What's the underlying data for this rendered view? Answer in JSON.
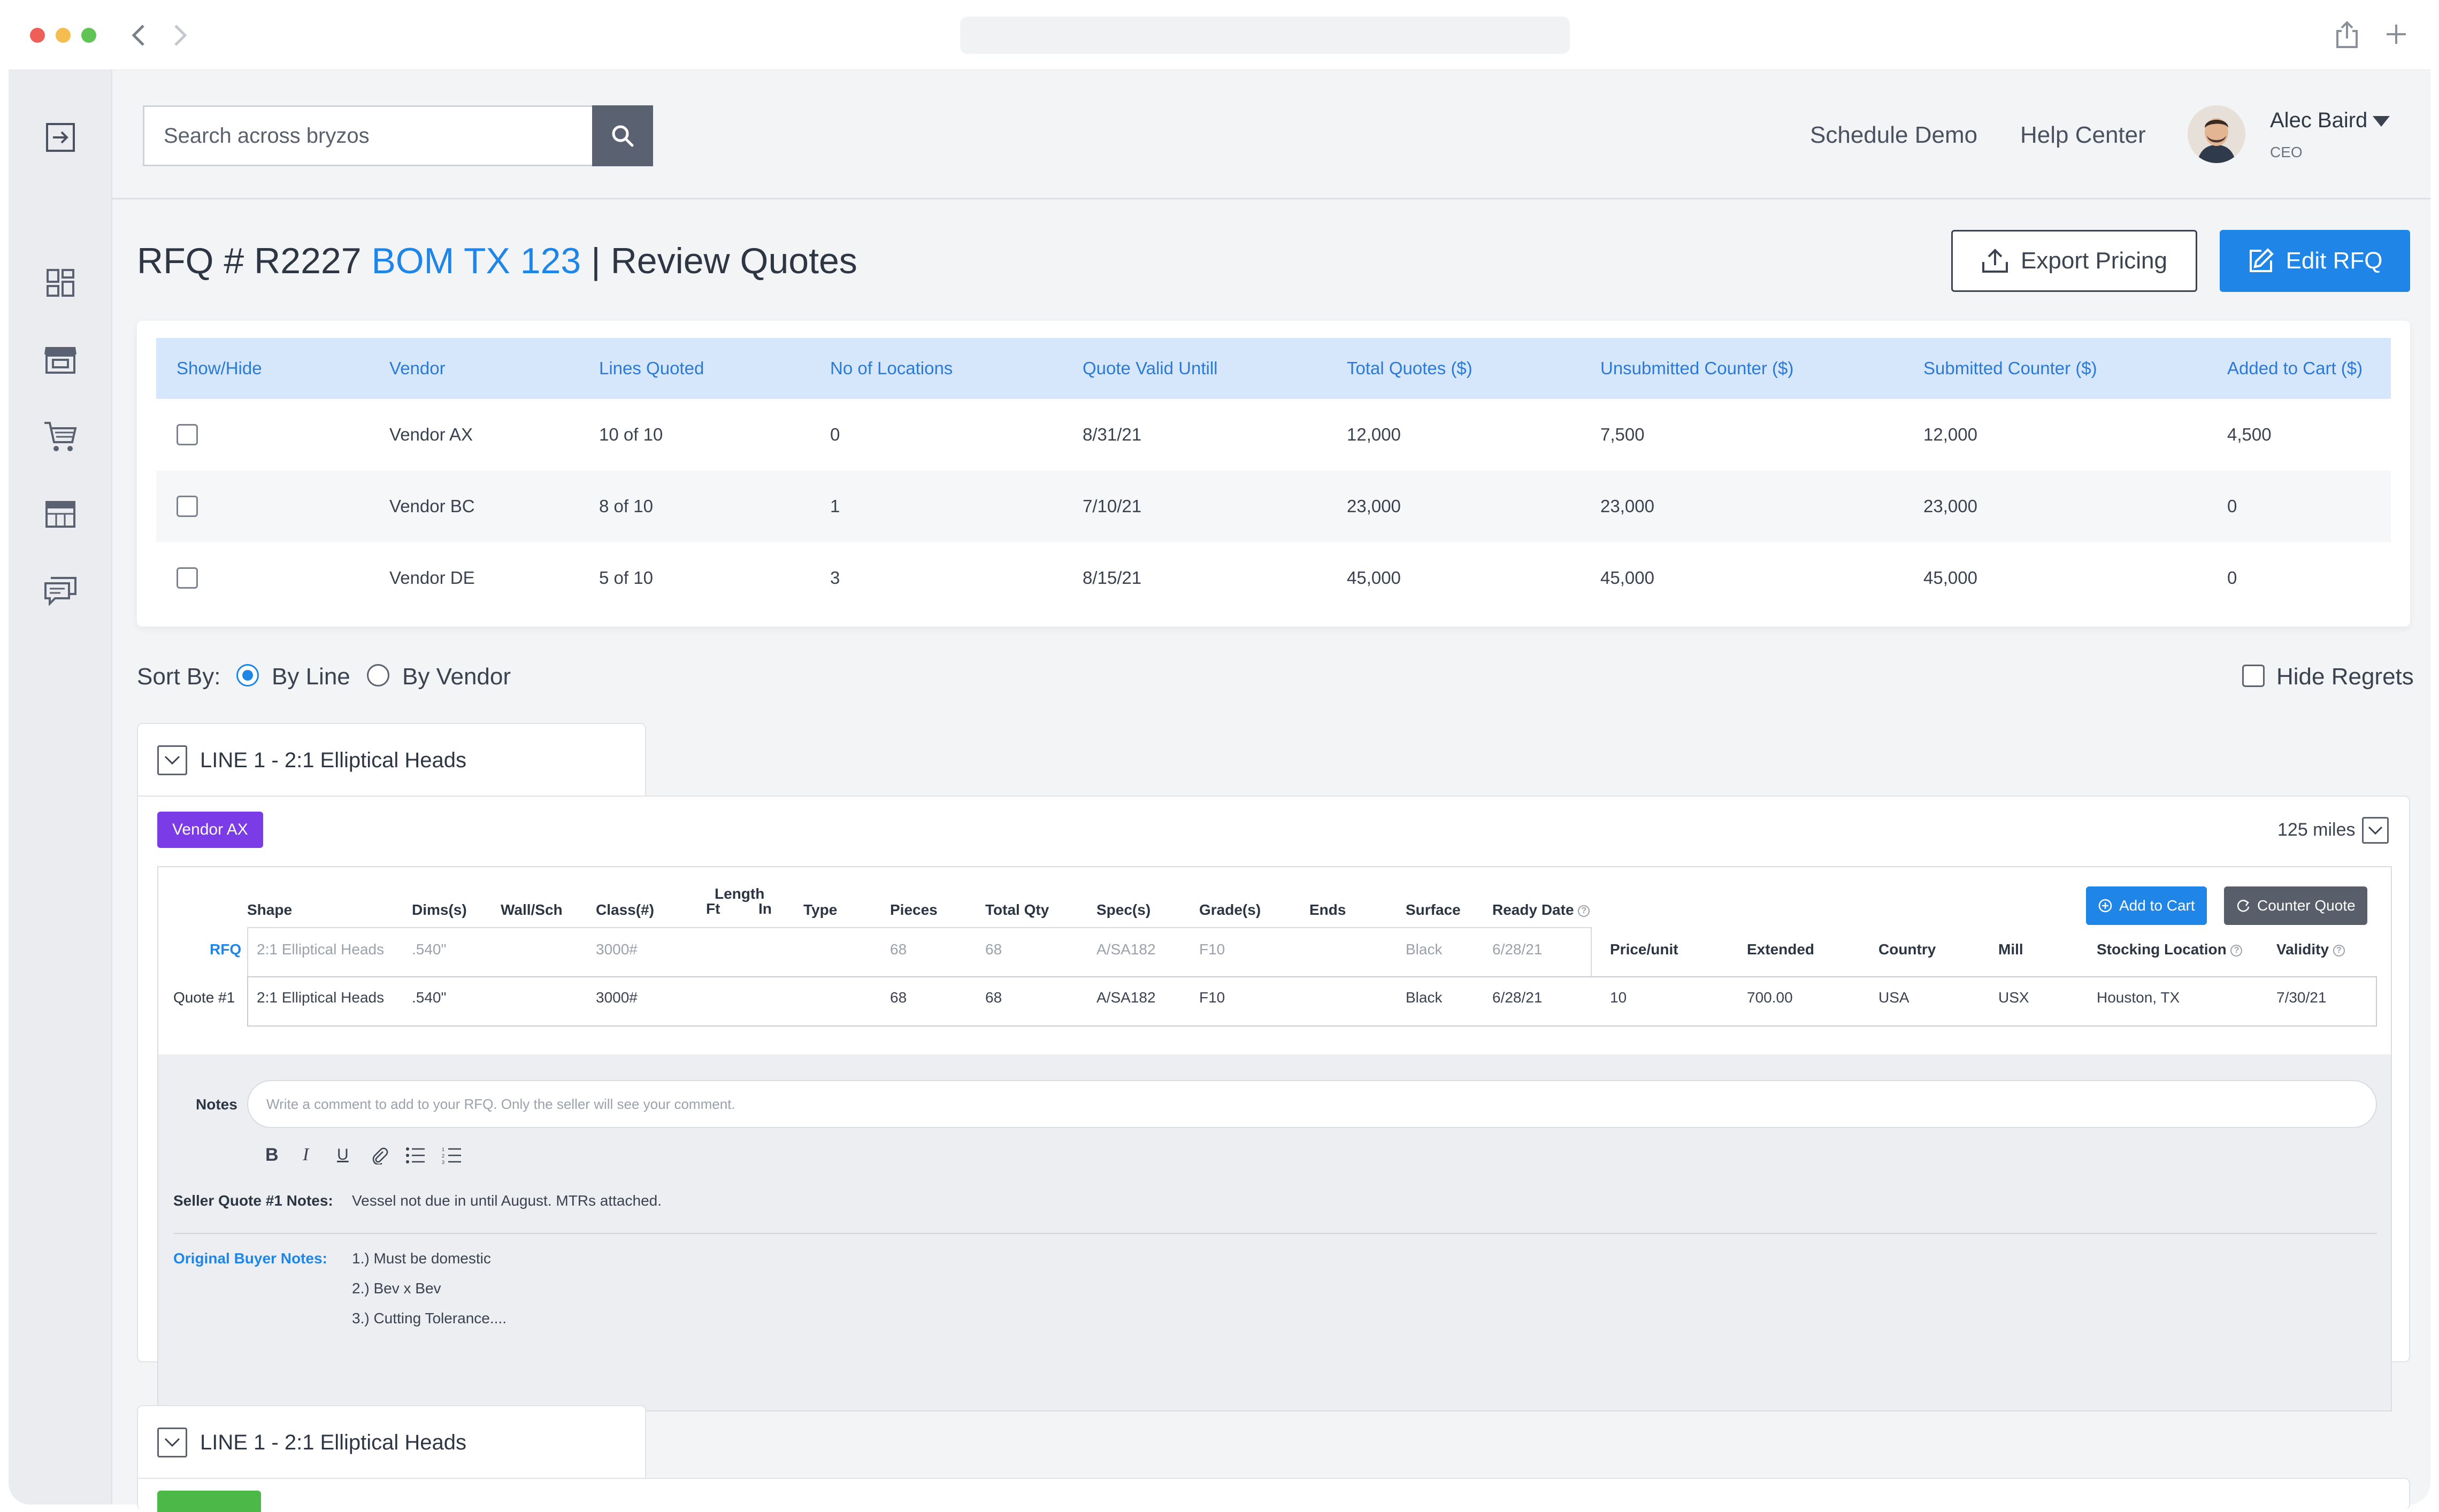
{
  "search": {
    "placeholder": "Search across bryzos"
  },
  "header": {
    "schedule_demo": "Schedule Demo",
    "help_center": "Help Center",
    "user_name": "Alec Baird",
    "user_role": "CEO"
  },
  "page": {
    "title_prefix": "RFQ # R2227",
    "title_accent": "BOM TX 123",
    "title_suffix": "| Review Quotes",
    "export_label": "Export Pricing",
    "edit_label": "Edit RFQ"
  },
  "vendors": {
    "columns": [
      "Show/Hide",
      "Vendor",
      "Lines Quoted",
      "No of Locations",
      "Quote Valid Untill",
      "Total Quotes ($)",
      "Unsubmitted Counter ($)",
      "Submitted Counter ($)",
      "Added to Cart ($)"
    ],
    "rows": [
      {
        "vendor": "Vendor AX",
        "lines": "10 of 10",
        "locations": "0",
        "valid": "8/31/21",
        "total": "12,000",
        "unsubmitted": "7,500",
        "submitted": "12,000",
        "cart": "4,500"
      },
      {
        "vendor": "Vendor BC",
        "lines": "8 of 10",
        "locations": "1",
        "valid": "7/10/21",
        "total": "23,000",
        "unsubmitted": "23,000",
        "submitted": "23,000",
        "cart": "0"
      },
      {
        "vendor": "Vendor DE",
        "lines": "5 of 10",
        "locations": "3",
        "valid": "8/15/21",
        "total": "45,000",
        "unsubmitted": "45,000",
        "submitted": "45,000",
        "cart": "0"
      }
    ]
  },
  "sort": {
    "label": "Sort By:",
    "by_line": "By Line",
    "by_vendor": "By Vendor",
    "selected": "By Line",
    "hide_regrets": "Hide Regrets"
  },
  "line1": {
    "title": "LINE 1 - 2:1 Elliptical Heads",
    "vendor_badge": "Vendor AX",
    "miles": "125 miles",
    "add_to_cart": "Add to Cart",
    "counter_quote": "Counter Quote",
    "headers": {
      "shape": "Shape",
      "dims": "Dims(s)",
      "wall": "Wall/Sch",
      "class": "Class(#)",
      "length": "Length",
      "ft": "Ft",
      "in": "In",
      "type": "Type",
      "pieces": "Pieces",
      "total_qty": "Total Qty",
      "spec": "Spec(s)",
      "grade": "Grade(s)",
      "ends": "Ends",
      "surface": "Surface",
      "ready_date": "Ready Date",
      "price_unit": "Price/unit",
      "extended": "Extended",
      "country": "Country",
      "mill": "Mill",
      "stocking": "Stocking Location",
      "validity": "Validity"
    },
    "rfq_label": "RFQ",
    "rfq": {
      "shape": "2:1 Elliptical Heads",
      "dims": ".540\"",
      "class": "3000#",
      "pieces": "68",
      "total_qty": "68",
      "spec": "A/SA182",
      "grade": "F10",
      "surface": "Black",
      "ready_date": "6/28/21"
    },
    "quote_label": "Quote #1",
    "quote": {
      "shape": "2:1 Elliptical Heads",
      "dims": ".540\"",
      "class": "3000#",
      "pieces": "68",
      "total_qty": "68",
      "spec": "A/SA182",
      "grade": "F10",
      "surface": "Black",
      "ready_date": "6/28/21",
      "price_unit": "10",
      "extended": "700.00",
      "country": "USA",
      "mill": "USX",
      "stocking": "Houston, TX",
      "validity": "7/30/21"
    },
    "notes_label": "Notes",
    "notes_placeholder": "Write a comment to add to your RFQ. Only the seller will see your comment.",
    "format_buttons": [
      "B",
      "I",
      "U"
    ],
    "seller_label": "Seller Quote #1 Notes:",
    "seller_text": "Vessel not due in until August. MTRs attached.",
    "buyer_label": "Original Buyer Notes:",
    "buyer_notes": [
      "1.) Must be domestic",
      "2.) Bev x Bev",
      "3.) Cutting Tolerance...."
    ]
  },
  "line2": {
    "title": "LINE 1 - 2:1 Elliptical Heads"
  },
  "colors": {
    "accent": "#1f86e8",
    "vendor_badge": "#7b3be7",
    "header_bg": "#d6e7fb",
    "green": "#4cb848"
  }
}
